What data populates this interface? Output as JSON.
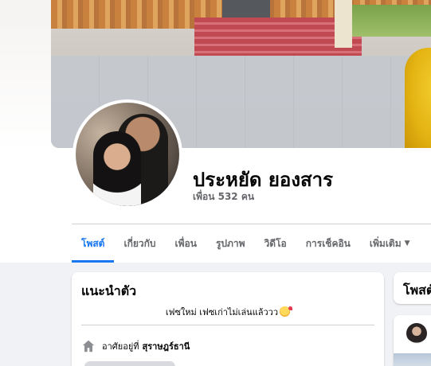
{
  "profile": {
    "name": "ประหยัด ยองสาร",
    "friends": "เพื่อน 532 คน"
  },
  "tabs": [
    {
      "label": "โพสต์",
      "active": true
    },
    {
      "label": "เกี่ยวกับ",
      "active": false
    },
    {
      "label": "เพื่อน",
      "active": false
    },
    {
      "label": "รูปภาพ",
      "active": false
    },
    {
      "label": "วิดีโอ",
      "active": false
    },
    {
      "label": "การเช็คอิน",
      "active": false
    },
    {
      "label": "เพิ่มเติม",
      "active": false,
      "dropdown": true
    }
  ],
  "intro": {
    "title": "แนะนำตัว",
    "bio": "เฟซใหม่ เฟซเก่าไม่เล่นแล้ววว",
    "bio_emoji": "face-with-hearts",
    "lives_prefix": "อาศัยอยู่ที่",
    "lives_city": "สุราษฎร์ธานี"
  },
  "posts": {
    "title": "โพสต์"
  },
  "colors": {
    "accent": "#1877f2",
    "background": "#f0f2f5",
    "secondary_text": "#65676b"
  },
  "icons": {
    "home": "home-icon",
    "caret": "caret-down-icon"
  }
}
